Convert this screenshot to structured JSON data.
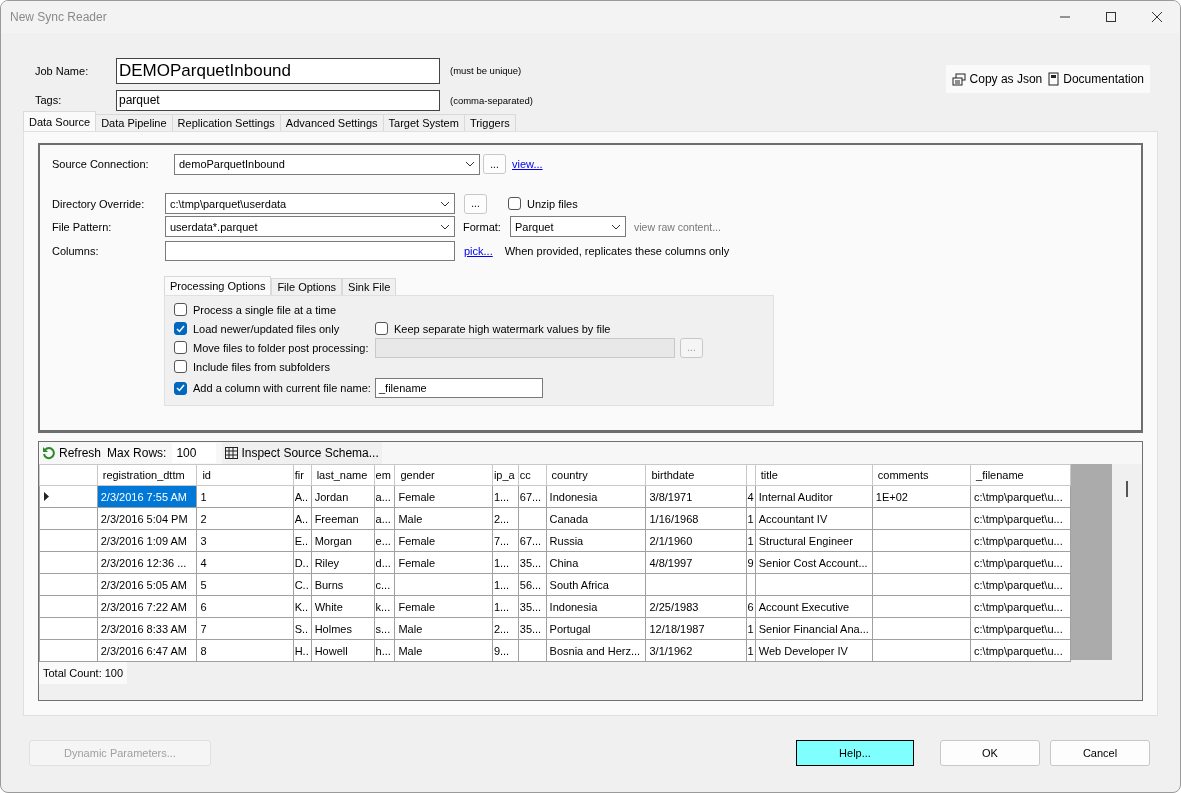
{
  "window": {
    "title": "New Sync Reader"
  },
  "job": {
    "name_label": "Job Name:",
    "name": "DEMOParquetInbound",
    "name_hint": "(must be unique)",
    "tags_label": "Tags:",
    "tags": "parquet",
    "tags_hint": "(comma-separated)"
  },
  "actions": [
    {
      "label": "Copy as Json",
      "kind": "copy"
    },
    {
      "label": "Documentation",
      "kind": "doc"
    }
  ],
  "tabs": [
    {
      "label": "Data Source",
      "selected": true
    },
    {
      "label": "Data Pipeline",
      "selected": false
    },
    {
      "label": "Replication Settings",
      "selected": false
    },
    {
      "label": "Advanced Settings",
      "selected": false
    },
    {
      "label": "Target System",
      "selected": false
    },
    {
      "label": "Triggers",
      "selected": false
    }
  ],
  "source": {
    "label": "Source Connection:",
    "value": "demoParquetInbound",
    "browse": "...",
    "link": "view..."
  },
  "directory": {
    "label": "Directory Override:",
    "value": "c:\\tmp\\parquet\\userdata",
    "browse": "...",
    "unzip": {
      "label": "Unzip files",
      "checked": false
    }
  },
  "pattern": {
    "label": "File Pattern:",
    "value": "userdata*.parquet",
    "format_label": "Format:",
    "format": "Parquet",
    "raw_link": "view raw content..."
  },
  "columns": {
    "label": "Columns:",
    "link": "pick...",
    "hint": "When provided, replicates these columns only"
  },
  "sub_tabs": [
    {
      "label": "Processing Options",
      "selected": true
    },
    {
      "label": "File Options",
      "selected": false
    },
    {
      "label": "Sink File",
      "selected": false
    }
  ],
  "options": [
    {
      "label": "Process a single file at a time",
      "checked": false
    },
    {
      "label": "Load newer/updated files only",
      "checked": true,
      "extra": {
        "label": "Keep separate high watermark values by file",
        "checked": false
      }
    },
    {
      "label": "Move files to folder post processing:",
      "checked": false,
      "field": {
        "disabled": true
      },
      "browse": "..."
    },
    {
      "label": "Include files from subfolders",
      "checked": false
    },
    {
      "label": "Add a column with current file name:",
      "checked": true,
      "field": {
        "value": "_filename",
        "disabled": false
      }
    }
  ],
  "grid_toolbar": {
    "refresh": "Refresh",
    "max_rows_label": "Max Rows:",
    "max_rows": "100",
    "inspect": "Inspect Source Schema..."
  },
  "grid": {
    "columns": [
      {
        "label": "registration_dttm"
      },
      {
        "label": "id"
      },
      {
        "label": "fir"
      },
      {
        "label": "last_name"
      },
      {
        "label": "em"
      },
      {
        "label": "gender"
      },
      {
        "label": "ip_a"
      },
      {
        "label": "cc"
      },
      {
        "label": "country"
      },
      {
        "label": "birthdate"
      },
      {},
      {
        "label": "title"
      },
      {
        "label": "comments"
      },
      {
        "label": "_filename"
      }
    ],
    "rows": [
      {
        "current": true,
        "cells": [
          "2/3/2016 7:55 AM",
          "1",
          "A..",
          "Jordan",
          "a...",
          "Female",
          "1...",
          "67...",
          "Indonesia",
          "3/8/1971",
          "4",
          "Internal Auditor",
          "1E+02",
          "c:\\tmp\\parquet\\u..."
        ]
      },
      {
        "current": false,
        "cells": [
          "2/3/2016 5:04 PM",
          "2",
          "A..",
          "Freeman",
          "a...",
          "Male",
          "2...",
          "",
          "Canada",
          "1/16/1968",
          "1",
          "Accountant IV",
          "",
          "c:\\tmp\\parquet\\u..."
        ]
      },
      {
        "current": false,
        "cells": [
          "2/3/2016 1:09 AM",
          "3",
          "E..",
          "Morgan",
          "e...",
          "Female",
          "7...",
          "67...",
          "Russia",
          "2/1/1960",
          "1",
          "Structural Engineer",
          "",
          "c:\\tmp\\parquet\\u..."
        ]
      },
      {
        "current": false,
        "cells": [
          "2/3/2016 12:36 ...",
          "4",
          "D..",
          "Riley",
          "d...",
          "Female",
          "1...",
          "35...",
          "China",
          "4/8/1997",
          "9",
          "Senior Cost Account...",
          "",
          "c:\\tmp\\parquet\\u..."
        ]
      },
      {
        "current": false,
        "cells": [
          "2/3/2016 5:05 AM",
          "5",
          "C..",
          "Burns",
          "c...",
          "",
          "1...",
          "56...",
          "South Africa",
          "",
          "",
          "",
          "",
          "c:\\tmp\\parquet\\u..."
        ]
      },
      {
        "current": false,
        "cells": [
          "2/3/2016 7:22 AM",
          "6",
          "K..",
          "White",
          "k...",
          "Female",
          "1...",
          "35...",
          "Indonesia",
          "2/25/1983",
          "6",
          "Account Executive",
          "",
          "c:\\tmp\\parquet\\u..."
        ]
      },
      {
        "current": false,
        "cells": [
          "2/3/2016 8:33 AM",
          "7",
          "S..",
          "Holmes",
          "s...",
          "Male",
          "2...",
          "35...",
          "Portugal",
          "12/18/1987",
          "1",
          "Senior Financial Ana...",
          "",
          "c:\\tmp\\parquet\\u..."
        ]
      },
      {
        "current": false,
        "cells": [
          "2/3/2016 6:47 AM",
          "8",
          "H..",
          "Howell",
          "h...",
          "Male",
          "9...",
          "",
          "Bosnia and Herz...",
          "3/1/1962",
          "1",
          "Web Developer IV",
          "",
          "c:\\tmp\\parquet\\u..."
        ]
      }
    ]
  },
  "total": "Total Count: 100",
  "footer": {
    "left": [
      {
        "label": "Dynamic Parameters...",
        "disabled": true
      }
    ],
    "right": [
      {
        "label": "Help...",
        "kind": "help",
        "disabled": false
      },
      {
        "label": "OK",
        "kind": "plain",
        "disabled": false
      },
      {
        "label": "Cancel",
        "kind": "plain",
        "disabled": false
      }
    ]
  }
}
